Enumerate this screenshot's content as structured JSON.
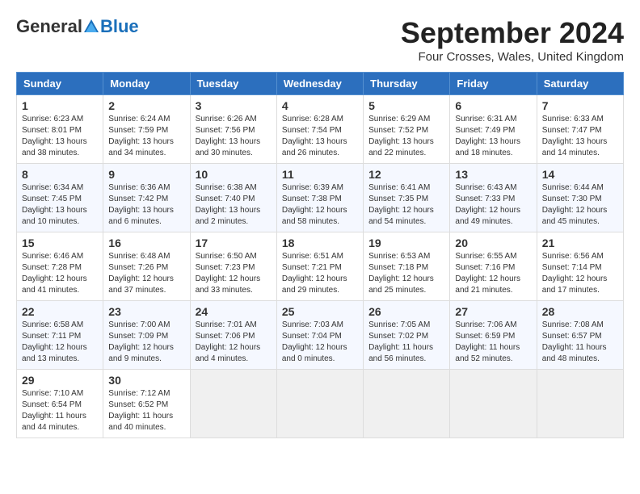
{
  "header": {
    "logo_general": "General",
    "logo_blue": "Blue",
    "month_title": "September 2024",
    "location": "Four Crosses, Wales, United Kingdom"
  },
  "days_of_week": [
    "Sunday",
    "Monday",
    "Tuesday",
    "Wednesday",
    "Thursday",
    "Friday",
    "Saturday"
  ],
  "weeks": [
    [
      {
        "day": "1",
        "sunrise": "6:23 AM",
        "sunset": "8:01 PM",
        "daylight": "13 hours and 38 minutes."
      },
      {
        "day": "2",
        "sunrise": "6:24 AM",
        "sunset": "7:59 PM",
        "daylight": "13 hours and 34 minutes."
      },
      {
        "day": "3",
        "sunrise": "6:26 AM",
        "sunset": "7:56 PM",
        "daylight": "13 hours and 30 minutes."
      },
      {
        "day": "4",
        "sunrise": "6:28 AM",
        "sunset": "7:54 PM",
        "daylight": "13 hours and 26 minutes."
      },
      {
        "day": "5",
        "sunrise": "6:29 AM",
        "sunset": "7:52 PM",
        "daylight": "13 hours and 22 minutes."
      },
      {
        "day": "6",
        "sunrise": "6:31 AM",
        "sunset": "7:49 PM",
        "daylight": "13 hours and 18 minutes."
      },
      {
        "day": "7",
        "sunrise": "6:33 AM",
        "sunset": "7:47 PM",
        "daylight": "13 hours and 14 minutes."
      }
    ],
    [
      {
        "day": "8",
        "sunrise": "6:34 AM",
        "sunset": "7:45 PM",
        "daylight": "13 hours and 10 minutes."
      },
      {
        "day": "9",
        "sunrise": "6:36 AM",
        "sunset": "7:42 PM",
        "daylight": "13 hours and 6 minutes."
      },
      {
        "day": "10",
        "sunrise": "6:38 AM",
        "sunset": "7:40 PM",
        "daylight": "13 hours and 2 minutes."
      },
      {
        "day": "11",
        "sunrise": "6:39 AM",
        "sunset": "7:38 PM",
        "daylight": "12 hours and 58 minutes."
      },
      {
        "day": "12",
        "sunrise": "6:41 AM",
        "sunset": "7:35 PM",
        "daylight": "12 hours and 54 minutes."
      },
      {
        "day": "13",
        "sunrise": "6:43 AM",
        "sunset": "7:33 PM",
        "daylight": "12 hours and 49 minutes."
      },
      {
        "day": "14",
        "sunrise": "6:44 AM",
        "sunset": "7:30 PM",
        "daylight": "12 hours and 45 minutes."
      }
    ],
    [
      {
        "day": "15",
        "sunrise": "6:46 AM",
        "sunset": "7:28 PM",
        "daylight": "12 hours and 41 minutes."
      },
      {
        "day": "16",
        "sunrise": "6:48 AM",
        "sunset": "7:26 PM",
        "daylight": "12 hours and 37 minutes."
      },
      {
        "day": "17",
        "sunrise": "6:50 AM",
        "sunset": "7:23 PM",
        "daylight": "12 hours and 33 minutes."
      },
      {
        "day": "18",
        "sunrise": "6:51 AM",
        "sunset": "7:21 PM",
        "daylight": "12 hours and 29 minutes."
      },
      {
        "day": "19",
        "sunrise": "6:53 AM",
        "sunset": "7:18 PM",
        "daylight": "12 hours and 25 minutes."
      },
      {
        "day": "20",
        "sunrise": "6:55 AM",
        "sunset": "7:16 PM",
        "daylight": "12 hours and 21 minutes."
      },
      {
        "day": "21",
        "sunrise": "6:56 AM",
        "sunset": "7:14 PM",
        "daylight": "12 hours and 17 minutes."
      }
    ],
    [
      {
        "day": "22",
        "sunrise": "6:58 AM",
        "sunset": "7:11 PM",
        "daylight": "12 hours and 13 minutes."
      },
      {
        "day": "23",
        "sunrise": "7:00 AM",
        "sunset": "7:09 PM",
        "daylight": "12 hours and 9 minutes."
      },
      {
        "day": "24",
        "sunrise": "7:01 AM",
        "sunset": "7:06 PM",
        "daylight": "12 hours and 4 minutes."
      },
      {
        "day": "25",
        "sunrise": "7:03 AM",
        "sunset": "7:04 PM",
        "daylight": "12 hours and 0 minutes."
      },
      {
        "day": "26",
        "sunrise": "7:05 AM",
        "sunset": "7:02 PM",
        "daylight": "11 hours and 56 minutes."
      },
      {
        "day": "27",
        "sunrise": "7:06 AM",
        "sunset": "6:59 PM",
        "daylight": "11 hours and 52 minutes."
      },
      {
        "day": "28",
        "sunrise": "7:08 AM",
        "sunset": "6:57 PM",
        "daylight": "11 hours and 48 minutes."
      }
    ],
    [
      {
        "day": "29",
        "sunrise": "7:10 AM",
        "sunset": "6:54 PM",
        "daylight": "11 hours and 44 minutes."
      },
      {
        "day": "30",
        "sunrise": "7:12 AM",
        "sunset": "6:52 PM",
        "daylight": "11 hours and 40 minutes."
      },
      {
        "day": "",
        "sunrise": "",
        "sunset": "",
        "daylight": ""
      },
      {
        "day": "",
        "sunrise": "",
        "sunset": "",
        "daylight": ""
      },
      {
        "day": "",
        "sunrise": "",
        "sunset": "",
        "daylight": ""
      },
      {
        "day": "",
        "sunrise": "",
        "sunset": "",
        "daylight": ""
      },
      {
        "day": "",
        "sunrise": "",
        "sunset": "",
        "daylight": ""
      }
    ]
  ]
}
